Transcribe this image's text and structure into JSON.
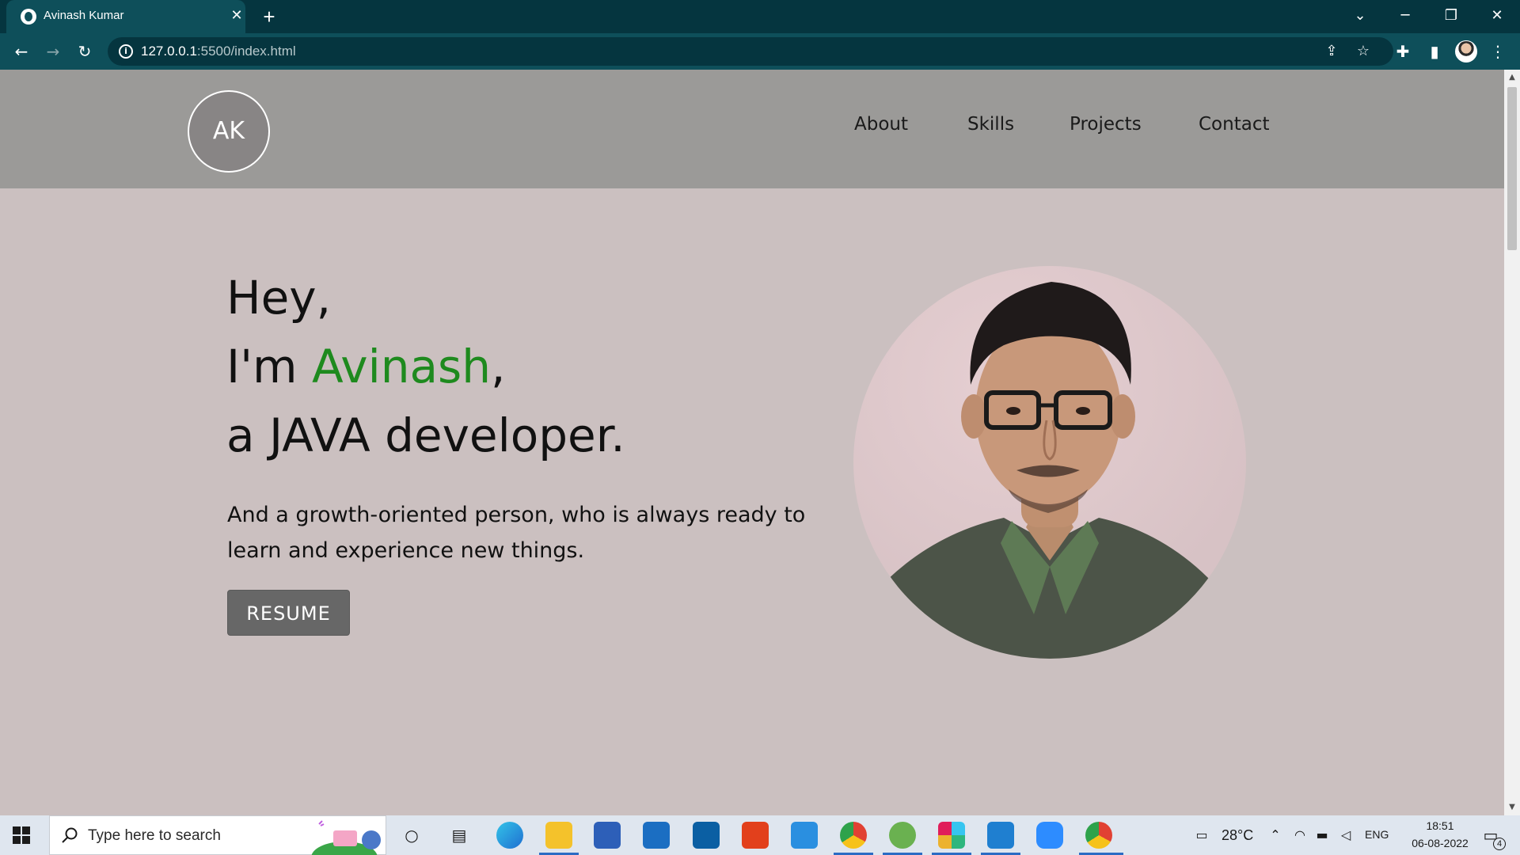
{
  "browser": {
    "tab_title": "Avinash Kumar",
    "url_host": "127.0.0.1",
    "url_rest": ":5500/index.html"
  },
  "site": {
    "logo_text": "AK",
    "nav": [
      {
        "label": "About"
      },
      {
        "label": "Skills"
      },
      {
        "label": "Projects"
      },
      {
        "label": "Contact"
      }
    ],
    "hero": {
      "line1": "Hey,",
      "line2_prefix": "I'm ",
      "name": "Avinash",
      "line2_suffix": ",",
      "line3": "a JAVA developer.",
      "tagline": "And a growth-oriented person, who is always ready to learn and experience new things.",
      "resume_label": "RESUME"
    },
    "colors": {
      "accent": "#1e8a1e",
      "header_bg": "#9b9a98",
      "page_bg": "#cbc0c0",
      "button_bg": "#676767"
    }
  },
  "taskbar": {
    "search_placeholder": "Type here to search",
    "weather": "28°C",
    "language": "ENG",
    "time": "18:51",
    "date": "06-08-2022",
    "notification_count": "4"
  }
}
